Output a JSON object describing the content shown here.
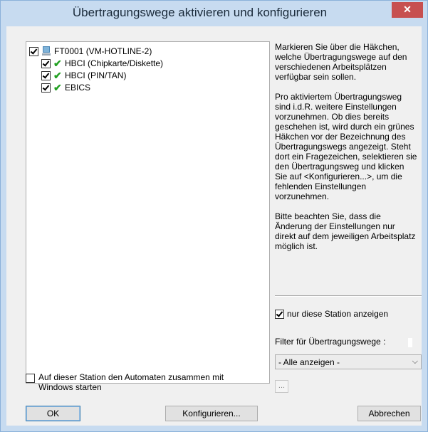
{
  "window": {
    "title": "Übertragungswege aktivieren und konfigurieren",
    "close_glyph": "✕"
  },
  "tree": {
    "root": {
      "label": "FT0001 (VM-HOTLINE-2)",
      "checked": true,
      "icon": "computer-icon"
    },
    "children": [
      {
        "label": "HBCI (Chipkarte/Diskette)",
        "checked": true,
        "status_icon": "green-check-icon",
        "glyph": "✔"
      },
      {
        "label": "HBCI (PIN/TAN)",
        "checked": true,
        "status_icon": "green-check-icon",
        "glyph": "✔"
      },
      {
        "label": "EBICS",
        "checked": true,
        "status_icon": "green-check-icon",
        "glyph": "✔"
      }
    ]
  },
  "help": {
    "p1": "Markieren Sie über die Häkchen, welche Übertragungswege auf den verschiedenen Arbeitsplätzen verfügbar sein sollen.",
    "p2": "Pro aktiviertem Übertragungsweg sind i.d.R. weitere Einstellungen vorzunehmen. Ob dies bereits geschehen ist, wird durch ein grünes Häkchen vor der Bezeichnung des Übertragungswegs angezeigt. Steht dort ein Fragezeichen, selektieren sie den Übertragungsweg und klicken Sie auf <Konfigurieren...>, um die fehlenden Einstellungen vorzunehmen.",
    "p3": "Bitte beachten Sie, dass die Änderung der Einstellungen nur direkt auf dem jeweiligen Arbeitsplatz möglich ist."
  },
  "station_filter": {
    "label": "nur diese Station anzeigen",
    "checked": true
  },
  "filter": {
    "label": "Filter für Übertragungswege :",
    "selected": "- Alle anzeigen -",
    "chevron": "⌵"
  },
  "dots_button": "...",
  "autostart": {
    "label_line1": "Auf dieser Station den Automaten zusammen mit",
    "label_line2": "Windows starten",
    "checked": false
  },
  "buttons": {
    "ok": "OK",
    "configure": "Konfigurieren...",
    "cancel": "Abbrechen"
  },
  "colors": {
    "titlebar": "#c7dbf0",
    "close": "#c75050",
    "check_green": "#22a022",
    "dialog_bg": "#f0f0f0"
  }
}
